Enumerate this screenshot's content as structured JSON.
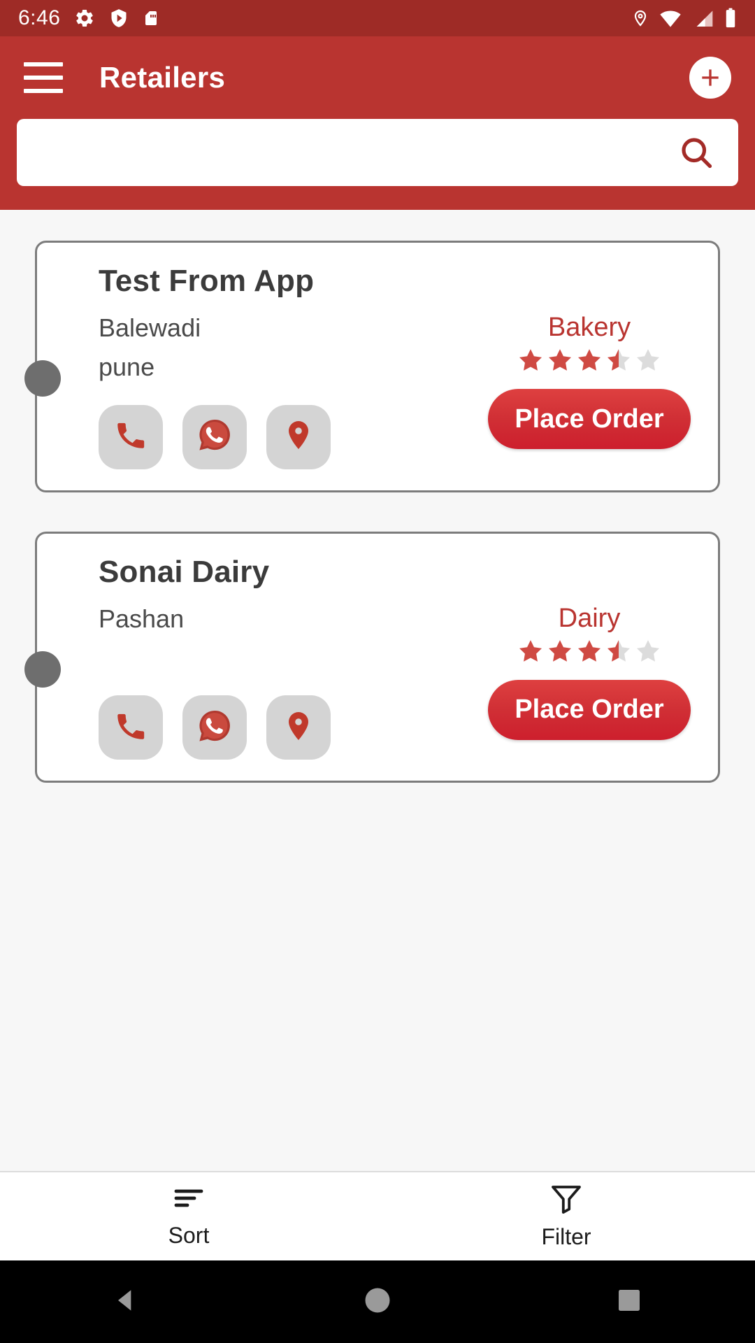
{
  "status_bar": {
    "time": "6:46",
    "left_icons": [
      "gear-icon",
      "shield-play-icon",
      "sd-card-icon"
    ],
    "right_icons": [
      "location-icon",
      "wifi-icon",
      "cellular-signal-icon",
      "battery-icon"
    ]
  },
  "app_bar": {
    "menu_icon": "hamburger-menu-icon",
    "title": "Retailers",
    "add_icon": "plus-icon",
    "accent_color": "#b93430",
    "status_bar_color": "#9e2b26"
  },
  "search": {
    "value": "",
    "placeholder": "",
    "icon": "search-icon"
  },
  "retailers": [
    {
      "name": "Test From App",
      "address_line1": "Balewadi",
      "address_line2": "pune",
      "category": "Bakery",
      "rating": 3.5,
      "max_rating": 5,
      "actions": [
        "phone-icon",
        "whatsapp-icon",
        "location-pin-icon"
      ],
      "order_button_label": "Place Order"
    },
    {
      "name": "Sonai Dairy",
      "address_line1": "Pashan",
      "address_line2": "",
      "category": "Dairy",
      "rating": 3.5,
      "max_rating": 5,
      "actions": [
        "phone-icon",
        "whatsapp-icon",
        "location-pin-icon"
      ],
      "order_button_label": "Place Order"
    }
  ],
  "bottom_bar": {
    "items": [
      {
        "label": "Sort",
        "icon": "sort-icon"
      },
      {
        "label": "Filter",
        "icon": "filter-funnel-icon"
      }
    ]
  },
  "nav_bar": {
    "back": "back-triangle-icon",
    "home": "home-circle-icon",
    "recents": "recents-square-icon"
  },
  "colors": {
    "primary": "#b93430",
    "primary_dark": "#9e2b26",
    "button_red": "#cd1f2d",
    "star_filled": "#cf4a43",
    "star_empty": "#dcdcdc",
    "card_border": "#7c7c7c",
    "page_bg": "#f7f7f7"
  }
}
